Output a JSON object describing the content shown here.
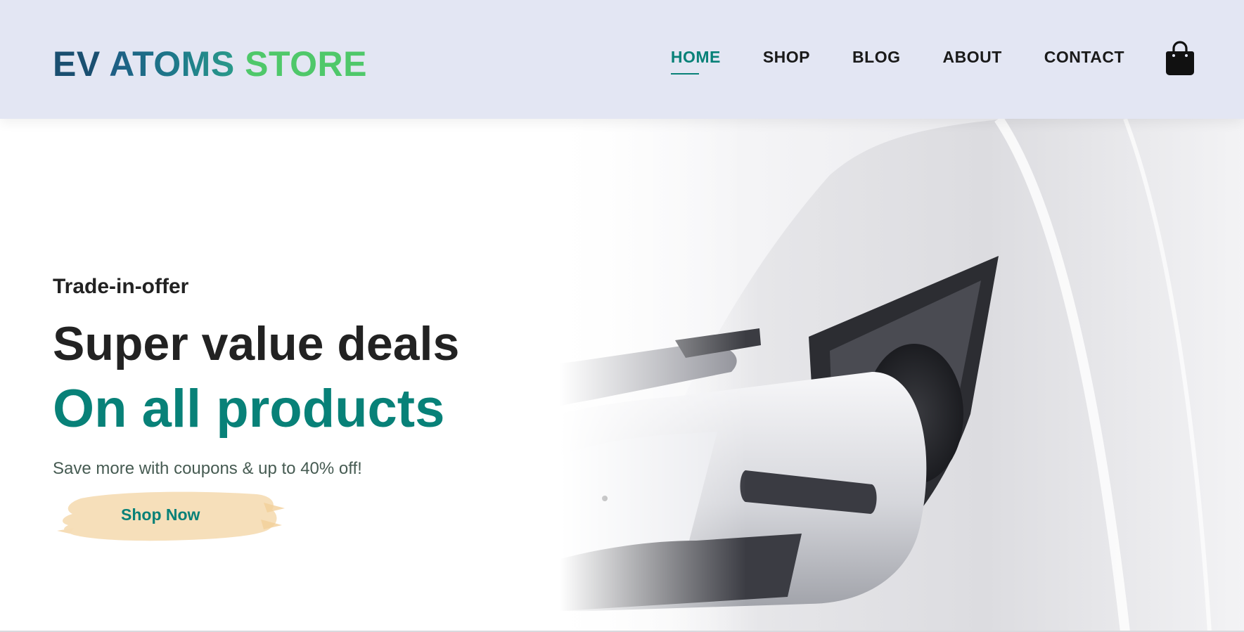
{
  "header": {
    "logo": {
      "part1": "EV",
      "part2": "ATOMS",
      "part3": "STORE"
    },
    "nav": [
      {
        "label": "HOME",
        "active": true
      },
      {
        "label": "SHOP",
        "active": false
      },
      {
        "label": "BLOG",
        "active": false
      },
      {
        "label": "ABOUT",
        "active": false
      },
      {
        "label": "CONTACT",
        "active": false
      }
    ],
    "cart_icon": "shopping-bag-icon"
  },
  "hero": {
    "kicker": "Trade-in-offer",
    "headline": "Super value deals",
    "headline_accent": "On all products",
    "subtext": "Save more with coupons & up to 40% off!",
    "cta_label": "Shop Now",
    "image": "ev-charging-plug-photo"
  },
  "colors": {
    "header_bg": "#e3e6f3",
    "accent": "#088178",
    "logo_dark": "#1a4f70",
    "logo_green": "#4fc86a",
    "cta_brush": "#f6ddb6",
    "text_dark": "#222222"
  }
}
